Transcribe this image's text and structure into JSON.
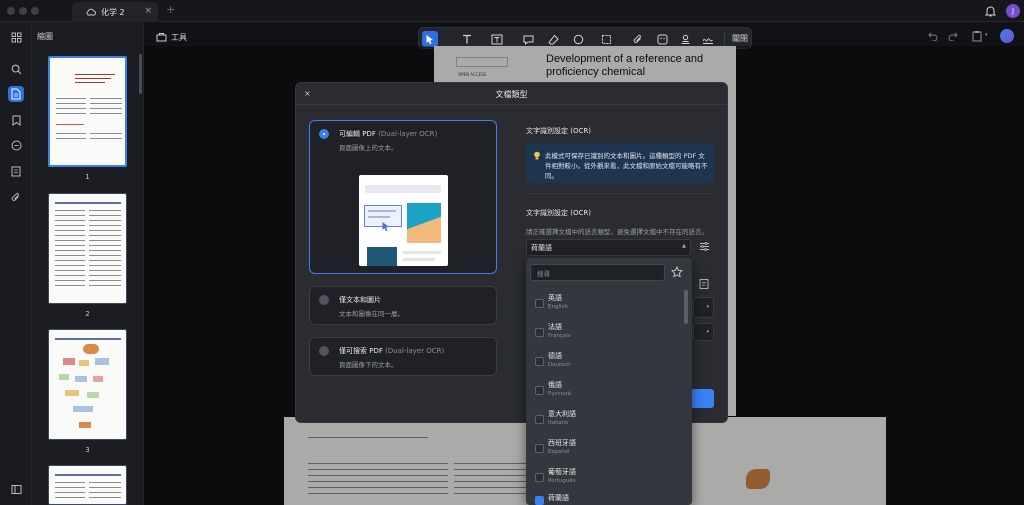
{
  "titlebar": {
    "tab_label": "化学 2",
    "tab_close": "×",
    "new_tab": "+",
    "avatar_initial": "J"
  },
  "thumbnails": {
    "title": "縮圖",
    "pages": [
      "1",
      "2",
      "3"
    ]
  },
  "toolbar": {
    "tools_label": "工具",
    "close_label": "關閉"
  },
  "document": {
    "title": "Development of a reference and proficiency chemical",
    "open_access": "OPEN ACCESS"
  },
  "dialog": {
    "close": "×",
    "title": "文檔類型",
    "options": [
      {
        "label": "可編輯 PDF",
        "label_en": "(Dual-layer OCR)",
        "desc": "頁面圖像上的文本。",
        "selected": true
      },
      {
        "label": "僅文本和圖片",
        "label_en": "",
        "desc": "文本和圖像在同一層。",
        "selected": false
      },
      {
        "label": "僅可搜索 PDF",
        "label_en": "(Dual-layer OCR)",
        "desc": "頁面圖像下的文本。",
        "selected": false
      }
    ],
    "ocr_section_title": "文字識別設定 (OCR)",
    "info_text": "此模式可保存已識別的文本和圖片。這種類型的 PDF 文件相對較小。從外觀來看，此文檔和原始文檔可能略有不同。",
    "ocr_lang_title": "文字識別設定 (OCR)",
    "ocr_lang_subtitle": "請正確選擇文檔中的語言類型，避免選擇文檔中不存在的語言。",
    "selected_language": "荷蘭語"
  },
  "dropdown": {
    "search_placeholder": "搜尋",
    "languages": [
      {
        "name": "英語",
        "native": "English",
        "checked": false
      },
      {
        "name": "法語",
        "native": "Français",
        "checked": false
      },
      {
        "name": "德語",
        "native": "Deutsch",
        "checked": false
      },
      {
        "name": "俄語",
        "native": "Русский",
        "checked": false
      },
      {
        "name": "意大利語",
        "native": "Italiano",
        "checked": false
      },
      {
        "name": "西班牙語",
        "native": "Español",
        "checked": false
      },
      {
        "name": "葡萄牙語",
        "native": "Português",
        "checked": false
      },
      {
        "name": "荷蘭語",
        "native": "",
        "checked": true
      }
    ]
  },
  "colors": {
    "accent": "#3b7ff0",
    "dialog_bg": "#2a2c32",
    "info_bg": "#1e3550"
  }
}
